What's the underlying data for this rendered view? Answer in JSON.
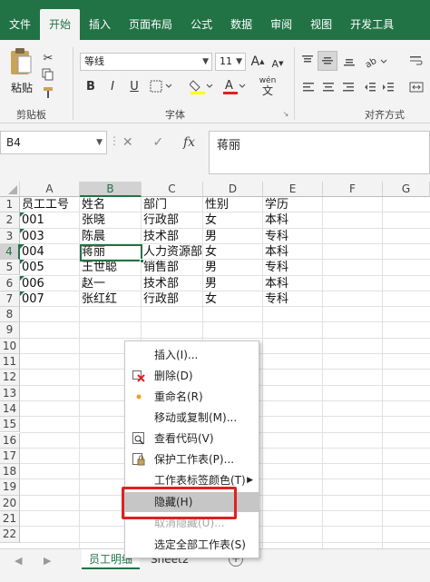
{
  "ribbon": {
    "tabs": [
      "文件",
      "开始",
      "插入",
      "页面布局",
      "公式",
      "数据",
      "审阅",
      "视图",
      "开发工具"
    ],
    "active_tab": "开始",
    "paste_label": "粘贴",
    "clipboard_group": "剪贴板",
    "font_group": "字体",
    "align_group": "对齐方式",
    "font_name": "等线",
    "font_size": "11",
    "bold": "B",
    "italic": "I",
    "underline": "U",
    "grow_font": "A",
    "shrink_font": "A",
    "wen": "wén",
    "wen_char": "文",
    "accent": "#217346"
  },
  "formula_bar": {
    "name_box": "B4",
    "cancel": "✕",
    "enter": "✓",
    "fx": "fx",
    "value": "蒋丽"
  },
  "grid": {
    "columns": [
      "A",
      "B",
      "C",
      "D",
      "E",
      "F",
      "G"
    ],
    "rows": [
      "1",
      "2",
      "3",
      "4",
      "5",
      "6",
      "7",
      "8",
      "9",
      "10",
      "11",
      "12",
      "13",
      "14",
      "15",
      "16",
      "17",
      "18",
      "19",
      "20",
      "21",
      "22"
    ],
    "selected_cell": "B4",
    "data": [
      [
        "员工工号",
        "姓名",
        "部门",
        "性别",
        "学历"
      ],
      [
        "001",
        "张晓",
        "行政部",
        "女",
        "本科"
      ],
      [
        "003",
        "陈晨",
        "技术部",
        "男",
        "专科"
      ],
      [
        "004",
        "蒋丽",
        "人力资源部",
        "女",
        "本科"
      ],
      [
        "005",
        "王世聪",
        "销售部",
        "男",
        "专科"
      ],
      [
        "006",
        "赵一",
        "技术部",
        "男",
        "本科"
      ],
      [
        "007",
        "张红红",
        "行政部",
        "女",
        "专科"
      ]
    ]
  },
  "sheets": {
    "tabs": [
      "员工明细",
      "Sheet2"
    ],
    "active": "员工明细",
    "add": "+"
  },
  "context_menu": {
    "items": [
      {
        "label": "插入(I)...",
        "icon": "",
        "state": "normal"
      },
      {
        "label": "删除(D)",
        "icon": "delete-sheet-icon",
        "state": "normal"
      },
      {
        "label": "重命名(R)",
        "icon": "rename-icon",
        "state": "normal"
      },
      {
        "label": "移动或复制(M)...",
        "icon": "",
        "state": "normal"
      },
      {
        "label": "查看代码(V)",
        "icon": "view-code-icon",
        "state": "normal"
      },
      {
        "label": "保护工作表(P)...",
        "icon": "protect-sheet-icon",
        "state": "normal"
      },
      {
        "label": "工作表标签颜色(T)",
        "icon": "",
        "state": "submenu"
      },
      {
        "label": "隐藏(H)",
        "icon": "",
        "state": "hover"
      },
      {
        "label": "取消隐藏(U)...",
        "icon": "",
        "state": "disabled"
      },
      {
        "label": "选定全部工作表(S)",
        "icon": "",
        "state": "normal"
      }
    ],
    "submenu_arrow": "▶",
    "highlight_color": "#e02020"
  }
}
